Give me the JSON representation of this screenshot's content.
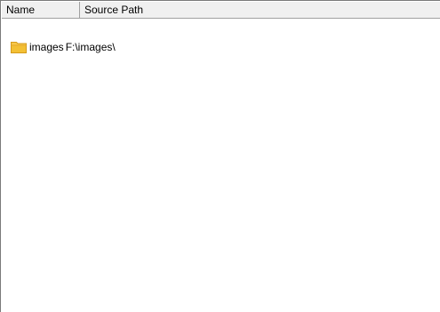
{
  "columns": {
    "name_label": "Name",
    "path_label": "Source Path"
  },
  "rows": [
    {
      "icon": "folder-icon",
      "name": "images",
      "path": "F:\\images\\"
    }
  ],
  "colors": {
    "header_bg": "#f0f0f0",
    "border": "#a0a0a0",
    "folder": "#f3c034"
  }
}
